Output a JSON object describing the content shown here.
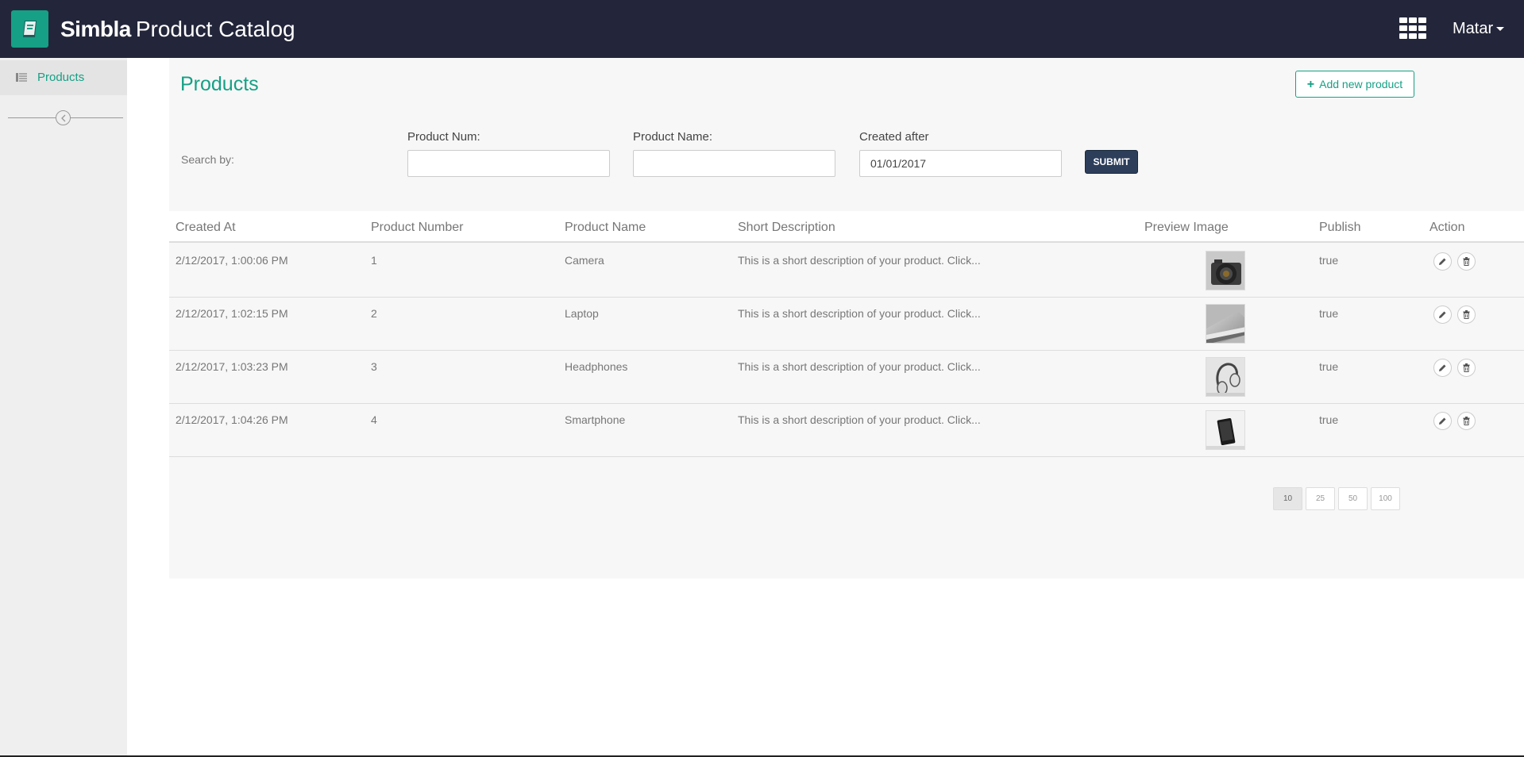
{
  "navbar": {
    "brand_bold": "Simbla",
    "brand_rest": "Product Catalog",
    "user_name": "Matar"
  },
  "sidebar": {
    "items": [
      {
        "label": "Products",
        "icon": "list-icon"
      }
    ]
  },
  "main": {
    "title": "Products",
    "add_button_label": "Add new product",
    "search": {
      "label": "Search by:",
      "product_num_label": "Product Num:",
      "product_num_value": "",
      "product_name_label": "Product Name:",
      "product_name_value": "",
      "created_after_label": "Created after",
      "created_after_value": "01/01/2017",
      "submit_label": "SUBMIT"
    },
    "table": {
      "columns": [
        "Created At",
        "Product Number",
        "Product Name",
        "Short Description",
        "Preview Image",
        "Publish",
        "Action"
      ],
      "rows": [
        {
          "created_at": "2/12/2017, 1:00:06 PM",
          "number": "1",
          "name": "Camera",
          "description": "This is a short description of your product. Click...",
          "image": "camera",
          "publish": "true"
        },
        {
          "created_at": "2/12/2017, 1:02:15 PM",
          "number": "2",
          "name": "Laptop",
          "description": "This is a short description of your product. Click...",
          "image": "laptop",
          "publish": "true"
        },
        {
          "created_at": "2/12/2017, 1:03:23 PM",
          "number": "3",
          "name": "Headphones",
          "description": "This is a short description of your product. Click...",
          "image": "headphones",
          "publish": "true"
        },
        {
          "created_at": "2/12/2017, 1:04:26 PM",
          "number": "4",
          "name": "Smartphone",
          "description": "This is a short description of your product. Click...",
          "image": "smartphone",
          "publish": "true"
        }
      ]
    },
    "page_sizes": [
      "10",
      "25",
      "50",
      "100"
    ],
    "active_page_size": "10"
  },
  "colors": {
    "navbar_bg": "#23263a",
    "accent": "#16a085",
    "submit_bg": "#2c3e5a"
  }
}
